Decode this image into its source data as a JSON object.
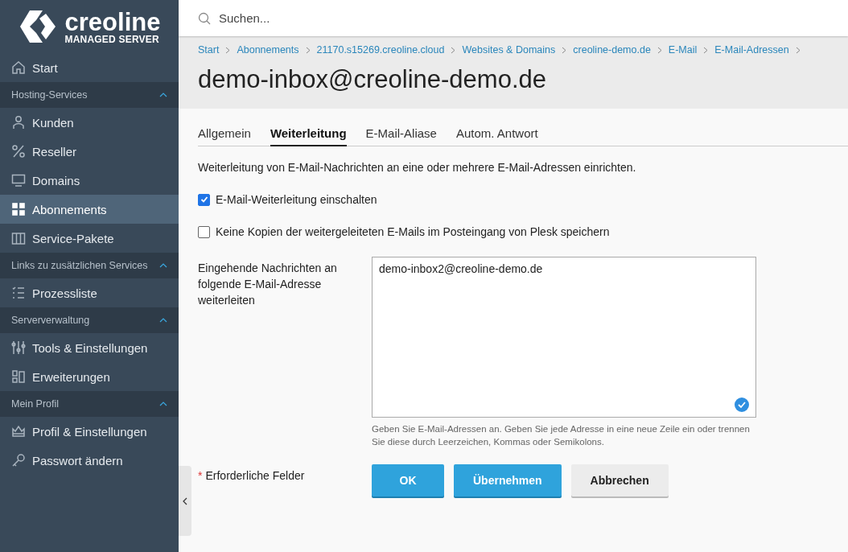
{
  "logo": {
    "name": "creoline",
    "tagline": "MANAGED SERVER"
  },
  "search": {
    "placeholder": "Suchen..."
  },
  "sidebar": {
    "items": [
      {
        "kind": "item",
        "label": "Start",
        "selected": false
      },
      {
        "kind": "section",
        "label": "Hosting-Services",
        "expanded": true
      },
      {
        "kind": "item",
        "label": "Kunden",
        "selected": false
      },
      {
        "kind": "item",
        "label": "Reseller",
        "selected": false
      },
      {
        "kind": "item",
        "label": "Domains",
        "selected": false
      },
      {
        "kind": "item",
        "label": "Abonnements",
        "selected": true
      },
      {
        "kind": "item",
        "label": "Service-Pakete",
        "selected": false
      },
      {
        "kind": "section",
        "label": "Links zu zusätzlichen Services",
        "expanded": true
      },
      {
        "kind": "item",
        "label": "Prozessliste",
        "selected": false
      },
      {
        "kind": "section",
        "label": "Serververwaltung",
        "expanded": true
      },
      {
        "kind": "item",
        "label": "Tools & Einstellungen",
        "selected": false
      },
      {
        "kind": "item",
        "label": "Erweiterungen",
        "selected": false
      },
      {
        "kind": "section",
        "label": "Mein Profil",
        "expanded": true
      },
      {
        "kind": "item",
        "label": "Profil & Einstellungen",
        "selected": false
      },
      {
        "kind": "item",
        "label": "Passwort ändern",
        "selected": false
      }
    ]
  },
  "breadcrumbs": [
    "Start",
    "Abonnements",
    "21170.s15269.creoline.cloud",
    "Websites & Domains",
    "creoline-demo.de",
    "E-Mail",
    "E-Mail-Adressen"
  ],
  "title": "demo-inbox@creoline-demo.de",
  "tabs": [
    {
      "label": "Allgemein",
      "selected": false
    },
    {
      "label": "Weiterleitung",
      "selected": true
    },
    {
      "label": "E-Mail-Aliase",
      "selected": false
    },
    {
      "label": "Autom. Antwort",
      "selected": false
    }
  ],
  "description": "Weiterleitung von E-Mail-Nachrichten an eine oder mehrere E-Mail-Adressen einrichten.",
  "checkboxes": [
    {
      "label": "E-Mail-Weiterleitung einschalten",
      "checked": true
    },
    {
      "label": "Keine Kopien der weitergeleiteten E-Mails im Posteingang von Plesk speichern",
      "checked": false
    }
  ],
  "forward_field": {
    "label": "Eingehende Nachrichten an folgende E-Mail-Adresse weiterleiten",
    "value": "demo-inbox2@creoline-demo.de",
    "hint": "Geben Sie E-Mail-Adressen an. Geben Sie jede Adresse in eine neue Zeile ein oder trennen Sie diese durch Leerzeichen, Kommas oder Semikolons."
  },
  "required_note": {
    "mark": "*",
    "label": "Erforderliche Felder"
  },
  "buttons": [
    {
      "label": "OK",
      "kind": "primary"
    },
    {
      "label": "Übernehmen",
      "kind": "primary"
    },
    {
      "label": "Abbrechen",
      "kind": "secondary"
    }
  ]
}
